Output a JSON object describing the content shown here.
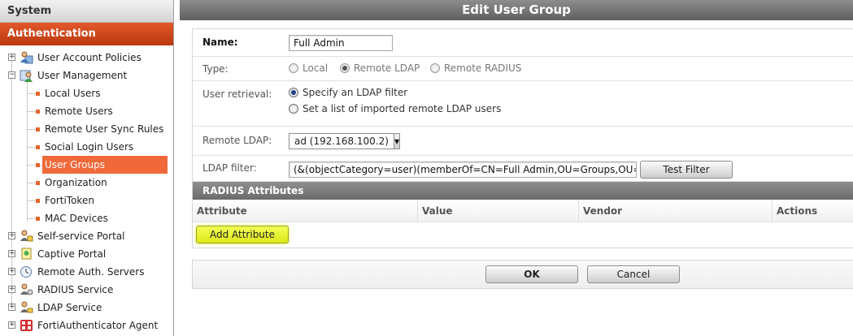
{
  "nav": {
    "system_label": "System",
    "auth_label": "Authentication",
    "items": [
      {
        "label": "User Account Policies",
        "icon": "user-policy-icon"
      },
      {
        "label": "User Management",
        "icon": "user-management-icon"
      },
      {
        "label": "Local Users"
      },
      {
        "label": "Remote Users"
      },
      {
        "label": "Remote User Sync Rules"
      },
      {
        "label": "Social Login Users"
      },
      {
        "label": "User Groups"
      },
      {
        "label": "Organization"
      },
      {
        "label": "FortiToken"
      },
      {
        "label": "MAC Devices"
      },
      {
        "label": "Self-service Portal",
        "icon": "self-service-icon"
      },
      {
        "label": "Captive Portal",
        "icon": "captive-portal-icon"
      },
      {
        "label": "Remote Auth. Servers",
        "icon": "remote-auth-icon"
      },
      {
        "label": "RADIUS Service",
        "icon": "radius-service-icon"
      },
      {
        "label": "LDAP Service",
        "icon": "ldap-service-icon"
      },
      {
        "label": "FortiAuthenticator Agent",
        "icon": "agent-icon"
      }
    ],
    "selected": "User Groups"
  },
  "page": {
    "title": "Edit User Group"
  },
  "form": {
    "name_label": "Name:",
    "name_value": "Full Admin",
    "type_label": "Type:",
    "type_options": [
      "Local",
      "Remote LDAP",
      "Remote RADIUS"
    ],
    "type_selected": "Remote LDAP",
    "retrieval_label": "User retrieval:",
    "retrieval_options": [
      "Specify an LDAP filter",
      "Set a list of imported remote LDAP users"
    ],
    "retrieval_selected": "Specify an LDAP filter",
    "remote_ldap_label": "Remote LDAP:",
    "remote_ldap_value": "ad (192.168.100.2)",
    "ldap_filter_label": "LDAP filter:",
    "ldap_filter_value": "(&(objectCategory=user)(memberOf=CN=Full Admin,OU=Groups,OU=Lab,DC",
    "test_filter_label": "Test Filter"
  },
  "radius": {
    "title": "RADIUS Attributes",
    "columns": [
      "Attribute",
      "Value",
      "Vendor",
      "Actions"
    ],
    "add_attribute_label": "Add Attribute"
  },
  "actions": {
    "ok_label": "OK",
    "cancel_label": "Cancel"
  },
  "colors": {
    "accent": "#f0693a",
    "auth_header": "#c9441a",
    "highlight": "#eaf530"
  }
}
